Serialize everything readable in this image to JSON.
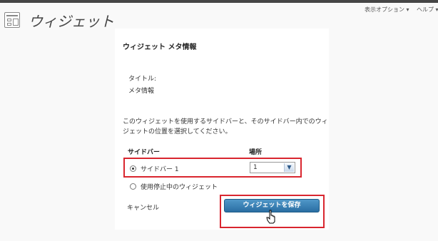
{
  "header": {
    "title": "ウィジェット",
    "screen_options": "表示オプション ▾",
    "help": "ヘルプ ▾"
  },
  "form": {
    "heading": "ウィジェット メタ情報",
    "title_label": "タイトル:",
    "title_value": "メタ情報",
    "description_line1": "このウィジェットを使用するサイドバーと、そのサイドバー内でのウィ",
    "description_line2": "ジェットの位置を選択してください。",
    "col_sidebar": "サイドバー",
    "col_position": "場所",
    "option_sidebar1": "サイドバー 1",
    "option_inactive": "使用停止中のウィジェット",
    "position_value": "1",
    "cancel": "キャンセル",
    "save": "ウィジェットを保存"
  },
  "colors": {
    "highlight": "#d9262f",
    "button": "#2a6ea3"
  },
  "icons": {
    "page": "widgets-icon",
    "cursor": "hand-pointer-icon"
  }
}
